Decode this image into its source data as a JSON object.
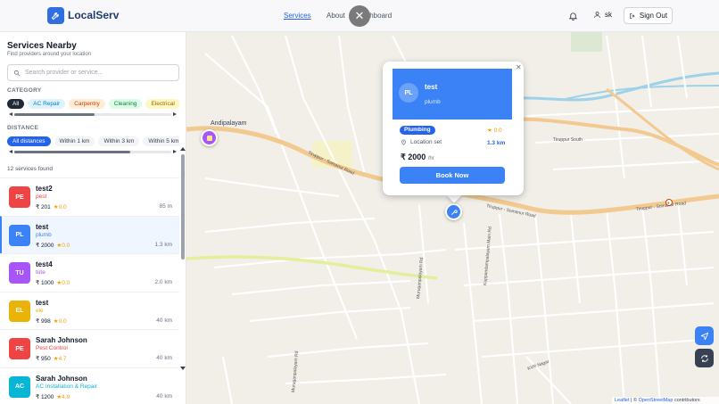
{
  "header": {
    "brand": "LocalServ",
    "nav": [
      "Services",
      "About",
      "Dashboard"
    ],
    "user": "sk",
    "signout": "Sign Out"
  },
  "sidebar": {
    "title": "Services Nearby",
    "subtitle": "Find providers around your location",
    "search_placeholder": "Search provider or service...",
    "category_label": "CATEGORY",
    "categories": [
      "All",
      "AC Repair",
      "Carpentry",
      "Cleaning",
      "Electrical"
    ],
    "distance_label": "DISTANCE",
    "distances": [
      "All distances",
      "Within 1 km",
      "Within 3 km",
      "Within 5 km"
    ],
    "found": "12 services found"
  },
  "services": [
    {
      "initials": "PE",
      "name": "test2",
      "category": "pest",
      "price": "₹ 201",
      "rating": "0.0",
      "distance": "85 m",
      "color": "#ef4444"
    },
    {
      "initials": "PL",
      "name": "test",
      "category": "plumb",
      "price": "₹ 2000",
      "rating": "0.0",
      "distance": "1.3 km",
      "color": "#3b82f6"
    },
    {
      "initials": "TU",
      "name": "test4",
      "category": "tute",
      "price": "₹ 1000",
      "rating": "0.0",
      "distance": "2.0 km",
      "color": "#a855f7"
    },
    {
      "initials": "EL",
      "name": "test",
      "category": "ele",
      "price": "₹ 998",
      "rating": "0.0",
      "distance": "40 km",
      "color": "#eab308"
    },
    {
      "initials": "PE",
      "name": "Sarah Johnson",
      "category": "Pest Control",
      "price": "₹ 950",
      "rating": "4.7",
      "distance": "40 km",
      "color": "#ef4444"
    },
    {
      "initials": "AC",
      "name": "Sarah Johnson",
      "category": "AC Installation & Repair",
      "price": "₹ 1200",
      "rating": "4.9",
      "distance": "40 km",
      "color": "#06b6d4"
    }
  ],
  "popup": {
    "initials": "PL",
    "name": "test",
    "category": "plumb",
    "badge": "Plumbing",
    "rating": "0.0",
    "location": "Location set",
    "distance": "1.3 km",
    "price": "₹ 2000",
    "unit": "/hr",
    "book": "Book Now"
  },
  "map": {
    "place": "Andipalayam",
    "roads": [
      "Tiruppur - Somanur Road",
      "Tiruppur South",
      "Muruganpalayam Rd",
      "Kuppandampalayam Main Rd",
      "KVR Nagar"
    ],
    "attribution": {
      "leaflet": "Leaflet",
      "sep": " | © ",
      "osm": "OpenStreetMap",
      "rest": " contributors"
    }
  }
}
